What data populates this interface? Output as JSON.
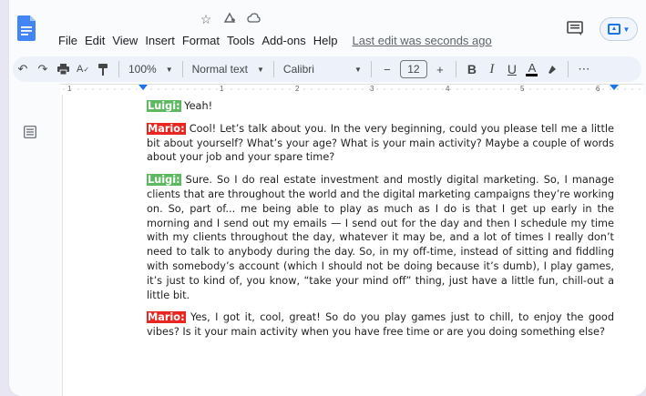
{
  "app": {
    "menu": [
      "File",
      "Edit",
      "View",
      "Insert",
      "Format",
      "Tools",
      "Add-ons",
      "Help"
    ],
    "last_edit": "Last edit was seconds ago",
    "title_icons": [
      "star-icon",
      "move-to-drive-icon",
      "cloud-status-icon"
    ]
  },
  "toolbar": {
    "zoom": "100%",
    "style": "Normal text",
    "font": "Calibri",
    "font_size": "12",
    "minus": "−",
    "plus": "+",
    "bold": "B",
    "italic": "I",
    "underline": "U",
    "text_color": "A",
    "more": "⋯"
  },
  "ruler": {
    "numbers": [
      "1",
      "1",
      "2",
      "3",
      "4",
      "5",
      "6"
    ]
  },
  "dialogue": [
    {
      "speaker": "Luigi:",
      "who": "luigi",
      "text": " Yeah!"
    },
    {
      "speaker": "Mario:",
      "who": "mario",
      "text": " Cool! Let’s talk about you. In the very beginning, could you please tell me a little bit about yourself? What’s your age? What is your main activity? Maybe a couple of words about your job and your spare time?"
    },
    {
      "speaker": "Luigi:",
      "who": "luigi",
      "text": " Sure. So I do real estate investment and mostly digital marketing. So, I manage clients that are throughout the world and the digital marketing campaigns they’re working on. So, part of... me being able to play as much as I do is that I get up early in the morning and I send out my emails — I  send out for the day and then I schedule my time with my clients throughout the day, whatever it may be, and a lot of times I really don’t need to talk to anybody during the day. So, in my off-time, instead of sitting and fiddling with somebody’s account (which I should not be doing because it’s dumb), I play games, it’s just to kind of, you know, “take your mind off” thing, just have a little fun, chill-out a little bit."
    },
    {
      "speaker": "Mario:",
      "who": "mario",
      "text": " Yes, I got it, cool, great! So do you play games just to chill, to enjoy the good vibes? Is it your main activity when you have free time or are you doing something else?"
    }
  ],
  "colors": {
    "luigi_label": "#5db95f",
    "mario_label": "#e8261f",
    "accent": "#1a73e8",
    "docs_blue": "#4285f4"
  }
}
